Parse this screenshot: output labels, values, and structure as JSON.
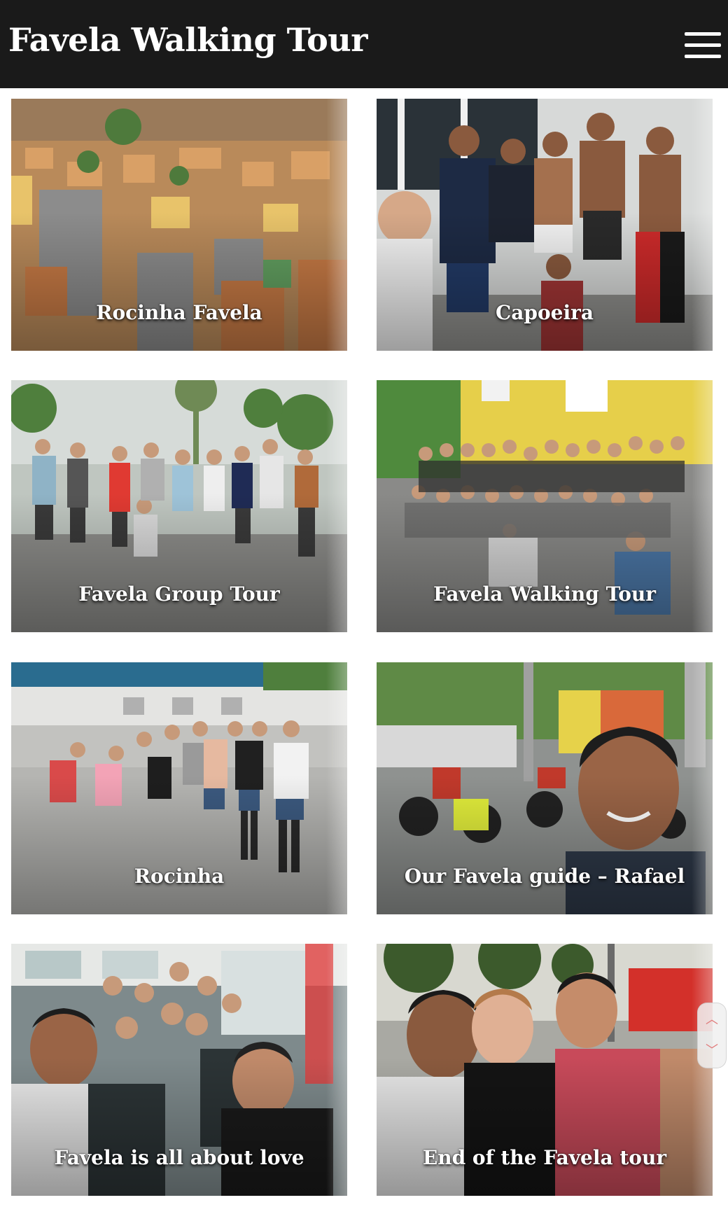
{
  "header": {
    "title": "Favela Walking Tour",
    "menu_icon": "hamburger-menu-icon"
  },
  "gallery": {
    "items": [
      {
        "label": "Rocinha Favela",
        "image": "photo-favela-hillside"
      },
      {
        "label": "Capoeira",
        "image": "photo-capoeira-group"
      },
      {
        "label": "Favela Group Tour",
        "image": "photo-group-tour-street"
      },
      {
        "label": "Favela Walking Tour",
        "image": "photo-large-group-yellow-wall"
      },
      {
        "label": "Rocinha",
        "image": "photo-group-rocinha-square"
      },
      {
        "label": "Our Favela guide – Rafael",
        "image": "photo-guide-selfie-motorbikes"
      },
      {
        "label": "Favela is all about love",
        "image": "photo-group-in-van"
      },
      {
        "label": "End of the Favela tour",
        "image": "photo-three-friends-selfie"
      }
    ]
  },
  "scroll_widget": {
    "up_icon": "chevron-up-icon",
    "down_icon": "chevron-down-icon"
  },
  "colors": {
    "header_bg": "#1a1a1a",
    "accent": "#e07a7a"
  }
}
